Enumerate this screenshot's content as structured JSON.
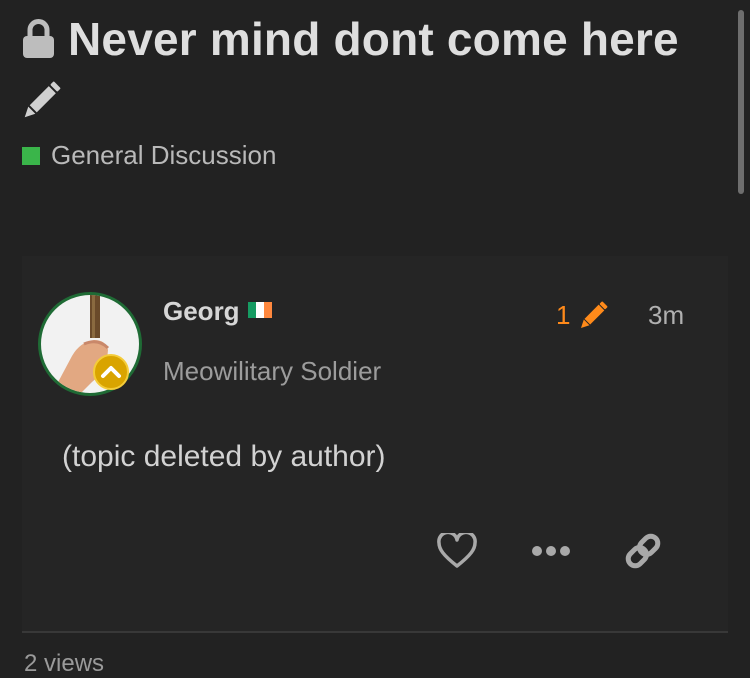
{
  "topic": {
    "title": "Never mind dont come here",
    "status_icon": "lock-icon",
    "edit_icon": "pencil-icon"
  },
  "category": {
    "name": "General Discussion",
    "color": "#3ab54a"
  },
  "post": {
    "username": "Georg",
    "flag_icon": "ireland-flag-icon",
    "user_title": "Meowilitary Soldier",
    "edit_count": "1",
    "time_ago": "3m",
    "content": "(topic deleted by author)",
    "avatar_ring_color": "#1f6b35",
    "badge_icon": "chevron-up-badge-icon"
  },
  "actions": {
    "like_icon": "heart-icon",
    "more_icon": "ellipsis-icon",
    "share_icon": "link-icon"
  },
  "footer": {
    "views": "2 views"
  },
  "colors": {
    "background": "#222222",
    "accent_orange": "#ff8a1a"
  }
}
